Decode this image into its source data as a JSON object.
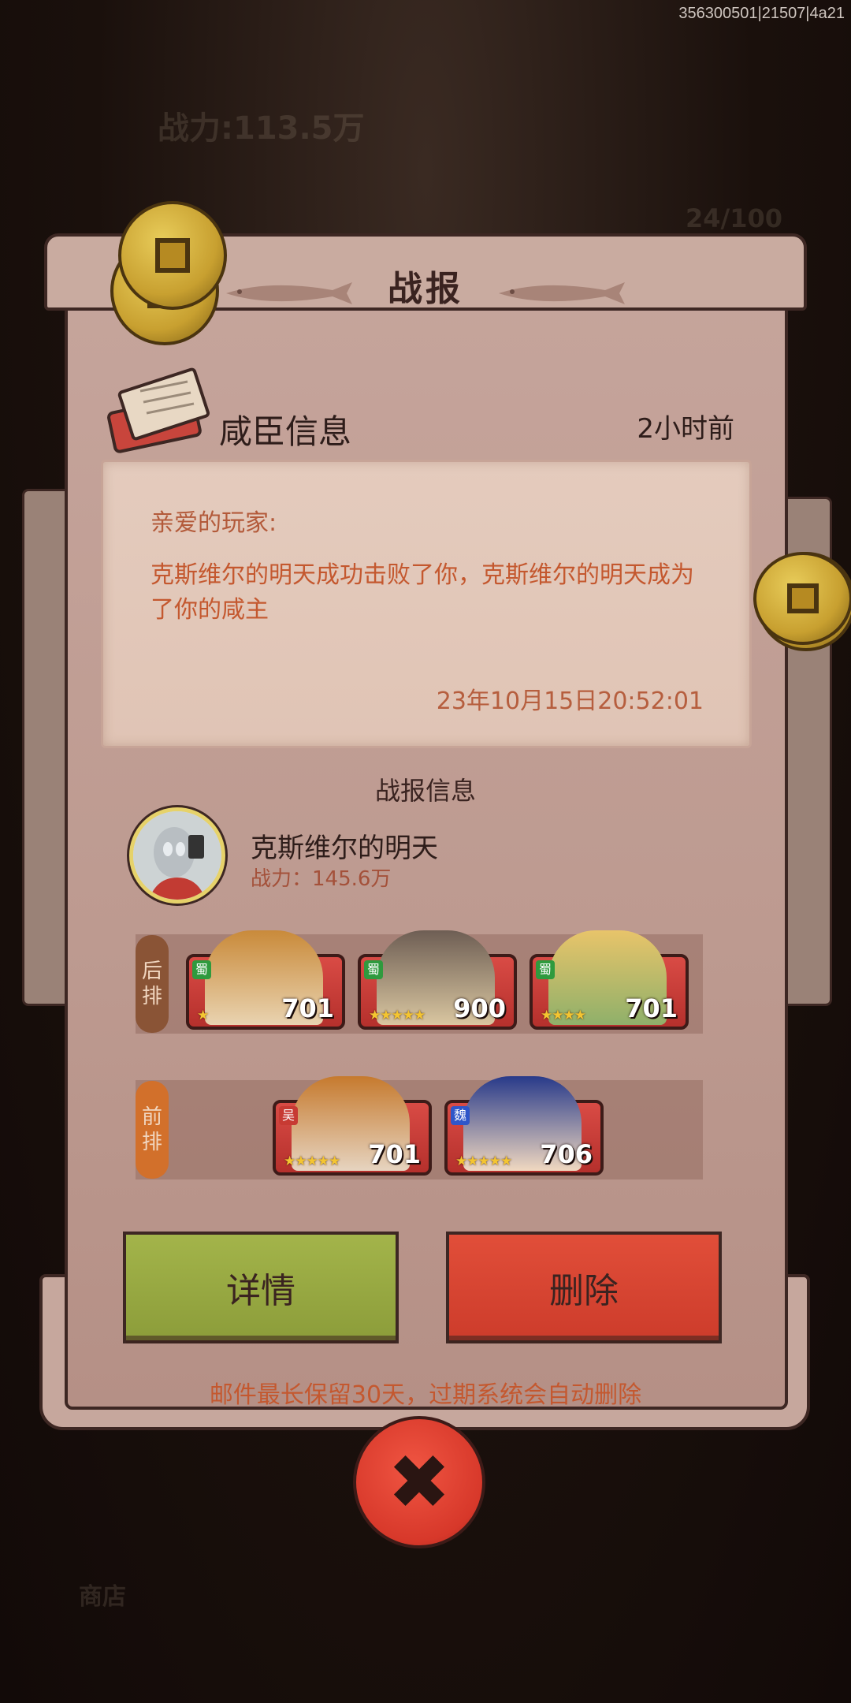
{
  "debug_id": "356300501|21507|4a21",
  "background": {
    "power_text": "战力:113.5万",
    "counter": "24/100",
    "bottom_label": "商店"
  },
  "dialog": {
    "title": "战报",
    "section_title": "咸臣信息",
    "time_ago": "2小时前",
    "message": {
      "greeting": "亲爱的玩家:",
      "body": "克斯维尔的明天成功击败了你，克斯维尔的明天成为了你的咸主",
      "date": "23年10月15日20:52:01"
    },
    "report_label": "战报信息",
    "player": {
      "name": "克斯维尔的明天",
      "power": "战力：145.6万"
    },
    "back_row": {
      "label": "后排",
      "heroes": [
        {
          "faction": "蜀",
          "stars": "★",
          "power": "701",
          "colors": [
            "#c98a3a",
            "#e9d3b0"
          ]
        },
        {
          "faction": "蜀",
          "stars": "★★★★★",
          "power": "900",
          "colors": [
            "#6e5e54",
            "#d9c6a0"
          ]
        },
        {
          "faction": "蜀",
          "stars": "★★★★",
          "power": "701",
          "colors": [
            "#e8c46a",
            "#8fb06a"
          ]
        }
      ]
    },
    "front_row": {
      "label": "前排",
      "heroes": [
        {
          "faction": "吴",
          "stars": "★★★★★",
          "power": "701",
          "colors": [
            "#c67a2e",
            "#e6d4c0"
          ]
        },
        {
          "faction": "魏",
          "stars": "★★★★★",
          "power": "706",
          "colors": [
            "#283a8a",
            "#f0d8c0"
          ]
        }
      ]
    },
    "buttons": {
      "detail": "详情",
      "delete": "删除"
    },
    "footer_note": "邮件最长保留30天，过期系统会自动删除",
    "close_symbol": "✖"
  },
  "colors": {
    "panel": "#c6a59c",
    "detail_button": "#a3b44a",
    "delete_button": "#e14e39",
    "accent_text": "#c4582f"
  }
}
